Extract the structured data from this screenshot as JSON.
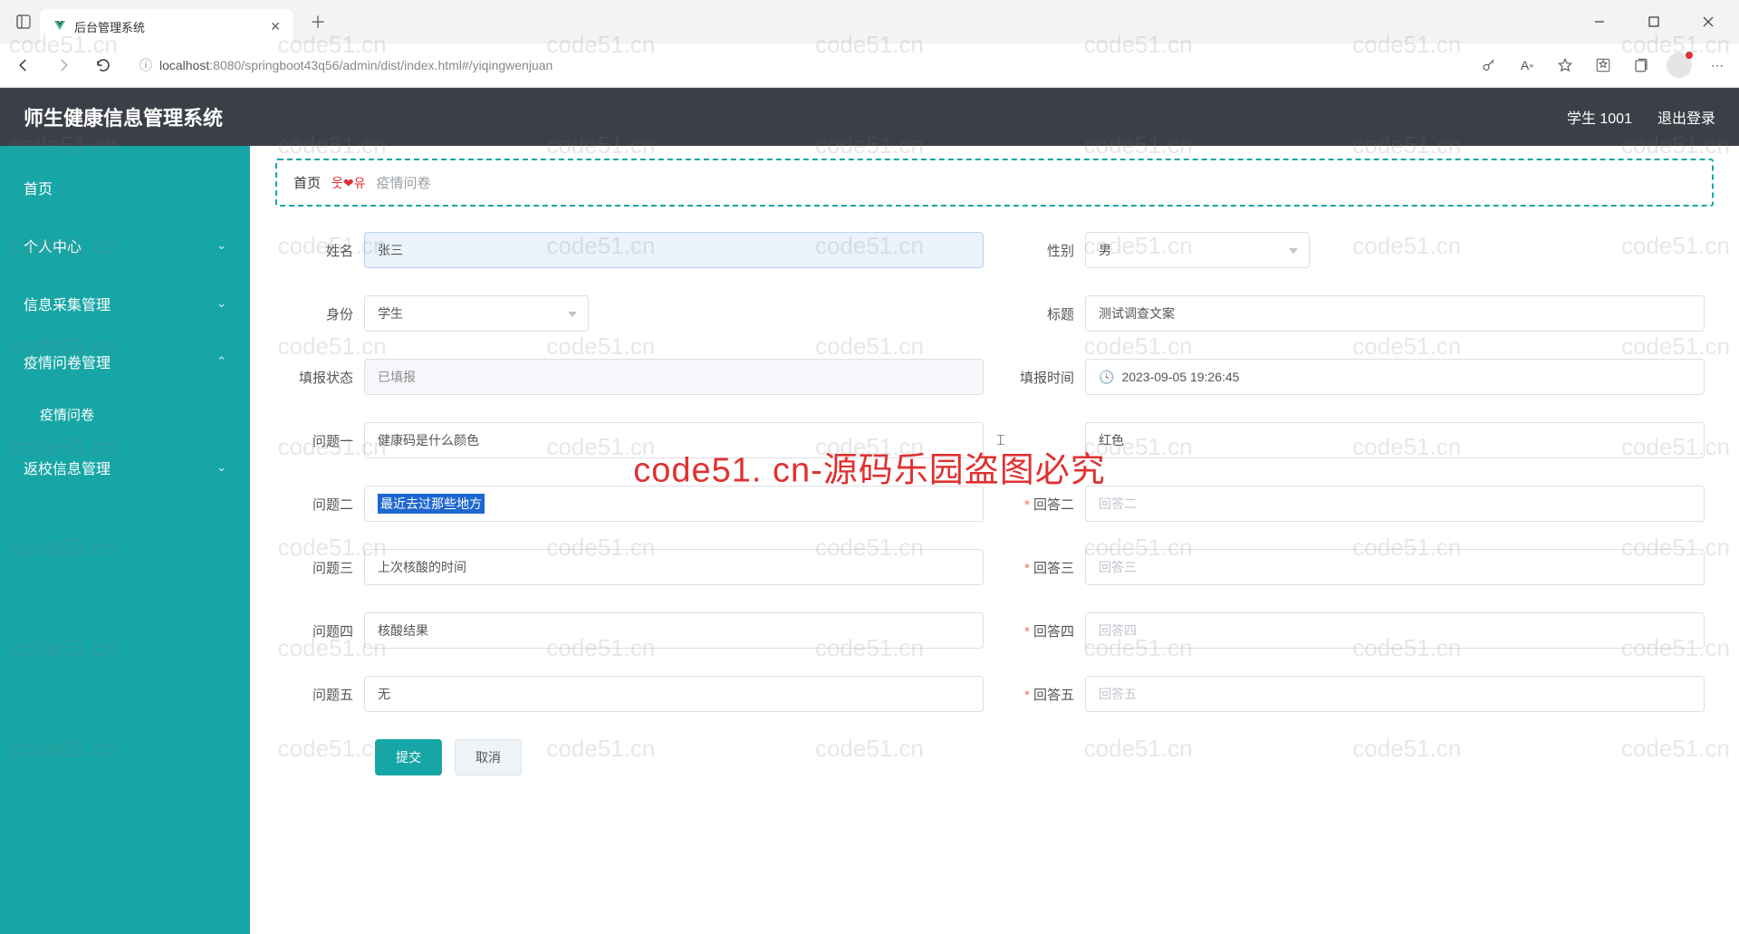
{
  "browser": {
    "tab_title": "后台管理系统",
    "url_host": "localhost",
    "url_port_path": ":8080/springboot43q56/admin/dist/index.html#/yiqingwenjuan"
  },
  "header": {
    "app_title": "师生健康信息管理系统",
    "user_label": "学生 1001",
    "logout": "退出登录"
  },
  "sidebar": {
    "home": "首页",
    "personal": "个人中心",
    "info_collect": "信息采集管理",
    "survey_mgmt": "疫情问卷管理",
    "survey_item": "疫情问卷",
    "return_mgmt": "返校信息管理"
  },
  "breadcrumb": {
    "home": "首页",
    "decor": "웃❤유",
    "current": "疫情问卷"
  },
  "form": {
    "name_label": "姓名",
    "name_value": "张三",
    "gender_label": "性别",
    "gender_value": "男",
    "identity_label": "身份",
    "identity_value": "学生",
    "title_label": "标题",
    "title_value": "测试调查文案",
    "fill_status_label": "填报状态",
    "fill_status_value": "已填报",
    "fill_time_label": "填报时间",
    "fill_time_value": "2023-09-05 19:26:45",
    "q1_label": "问题一",
    "q1_value": "健康码是什么颜色",
    "a1_value": "红色",
    "q2_label": "问题二",
    "q2_value": "最近去过那些地方",
    "a2_label": "回答二",
    "a2_placeholder": "回答二",
    "q3_label": "问题三",
    "q3_value": "上次核酸的时间",
    "a3_label": "回答三",
    "a3_placeholder": "回答三",
    "q4_label": "问题四",
    "q4_value": "核酸结果",
    "a4_label": "回答四",
    "a4_placeholder": "回答四",
    "q5_label": "问题五",
    "q5_value": "无",
    "a5_label": "回答五",
    "a5_placeholder": "回答五",
    "submit": "提交",
    "cancel": "取消"
  },
  "watermark": {
    "text": "code51.cn",
    "center": "code51. cn-源码乐园盗图必究"
  }
}
